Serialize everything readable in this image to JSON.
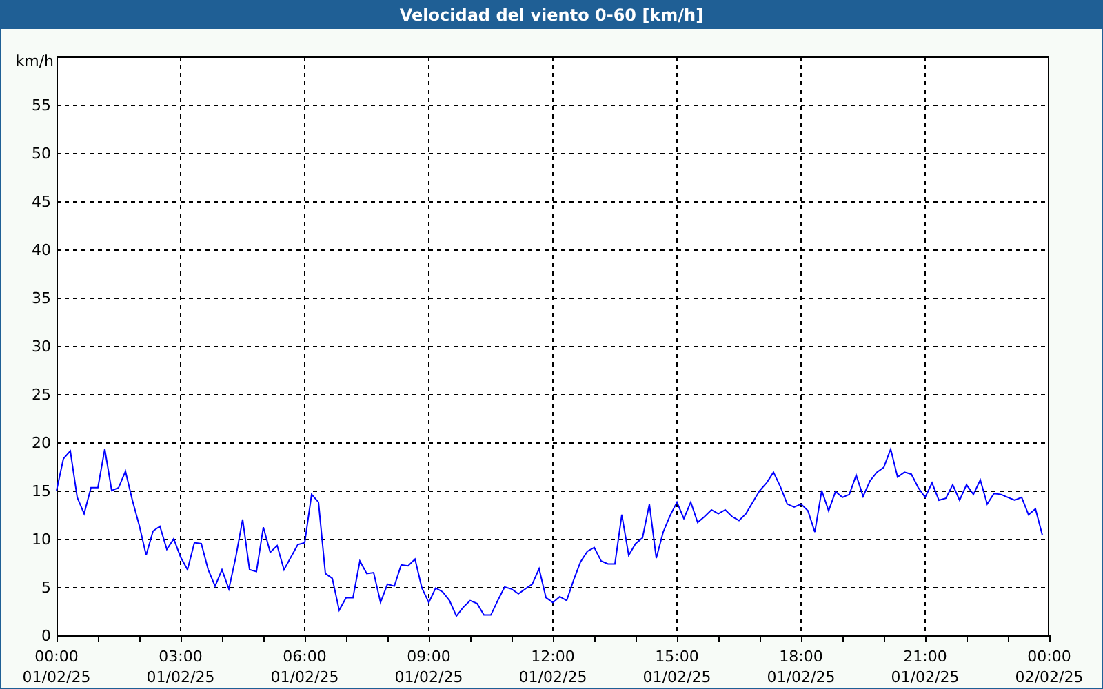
{
  "window": {
    "title": "Velocidad del viento 0-60 [km/h]"
  },
  "chart": {
    "chart_data": {
      "type": "line",
      "ylabel": "km/h",
      "ylim": [
        0,
        60
      ],
      "grid": true,
      "yticks": [
        0,
        5,
        10,
        15,
        20,
        25,
        30,
        35,
        40,
        45,
        50,
        55
      ],
      "categories": [
        "00:00 01/02/25",
        null,
        null,
        null,
        null,
        null,
        null,
        null,
        null,
        null,
        null,
        null,
        null,
        null,
        null,
        null,
        null,
        null,
        "03:00 01/02/25",
        null,
        null,
        null,
        null,
        null,
        null,
        null,
        null,
        null,
        null,
        null,
        null,
        null,
        null,
        null,
        null,
        null,
        "06:00 01/02/25",
        null,
        null,
        null,
        null,
        null,
        null,
        null,
        null,
        null,
        null,
        null,
        null,
        null,
        null,
        null,
        null,
        null,
        "09:00 01/02/25",
        null,
        null,
        null,
        null,
        null,
        null,
        null,
        null,
        null,
        null,
        null,
        null,
        null,
        null,
        null,
        null,
        null,
        "12:00 01/02/25",
        null,
        null,
        null,
        null,
        null,
        null,
        null,
        null,
        null,
        null,
        null,
        null,
        null,
        null,
        null,
        null,
        null,
        "15:00 01/02/25",
        null,
        null,
        null,
        null,
        null,
        null,
        null,
        null,
        null,
        null,
        null,
        null,
        null,
        null,
        null,
        null,
        null,
        "18:00 01/02/25",
        null,
        null,
        null,
        null,
        null,
        null,
        null,
        null,
        null,
        null,
        null,
        null,
        null,
        null,
        null,
        null,
        null,
        "21:00 01/02/25",
        null,
        null,
        null,
        null,
        null,
        null,
        null,
        null,
        null,
        null,
        null,
        null,
        null,
        null,
        null,
        null,
        null,
        "00:00 02/02/25"
      ],
      "series": [
        {
          "color": "#0000ff",
          "values": [
            15,
            18.3,
            19.1,
            14.3,
            12.6,
            15.3,
            15.3,
            19.3,
            15,
            15.3,
            17,
            14,
            11.4,
            8.3,
            10.8,
            11.3,
            8.9,
            10,
            8.1,
            6.8,
            9.6,
            9.5,
            6.8,
            5.1,
            6.8,
            4.8,
            8.1,
            12,
            6.8,
            6.6,
            11.2,
            8.6,
            9.3,
            6.8,
            8.1,
            9.4,
            9.6,
            14.6,
            13.8,
            6.4,
            5.9,
            2.6,
            3.9,
            3.9,
            7.7,
            6.4,
            6.5,
            3.4,
            5.3,
            5.1,
            7.3,
            7.2,
            7.9,
            4.9,
            3.4,
            4.9,
            4.5,
            3.6,
            2,
            2.9,
            3.6,
            3.3,
            2.1,
            2.1,
            3.6,
            5,
            4.8,
            4.3,
            4.8,
            5.3,
            6.9,
            3.9,
            3.4,
            4,
            3.6,
            5.7,
            7.6,
            8.7,
            9.1,
            7.7,
            7.4,
            7.4,
            12.5,
            8.3,
            9.5,
            10.1,
            13.6,
            8,
            10.7,
            12.4,
            13.8,
            12.1,
            13.8,
            11.7,
            12.3,
            13,
            12.6,
            13,
            12.3,
            11.9,
            12.6,
            13.8,
            15,
            15.8,
            16.9,
            15.4,
            13.6,
            13.3,
            13.6,
            12.9,
            10.7,
            15,
            12.9,
            14.9,
            14.3,
            14.6,
            16.6,
            14.4,
            16,
            16.9,
            17.4,
            19.3,
            16.4,
            16.9,
            16.7,
            15.3,
            14.3,
            15.8,
            14,
            14.2,
            15.6,
            14,
            15.6,
            14.6,
            16.1,
            13.6,
            14.7,
            14.6,
            14.3,
            14,
            14.3,
            12.5,
            13.1,
            10.4,
            null
          ]
        }
      ]
    }
  }
}
